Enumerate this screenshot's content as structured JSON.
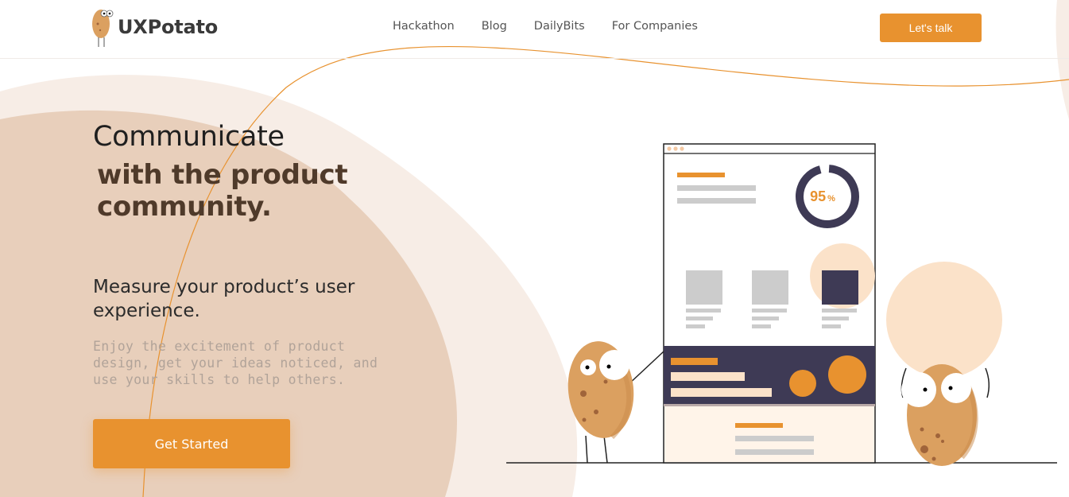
{
  "brand": {
    "name": "UXPotato"
  },
  "nav": {
    "links": [
      "Hackathon",
      "Blog",
      "DailyBits",
      "For Companies"
    ],
    "cta_label": "Let's talk"
  },
  "hero": {
    "headline_line1": "Communicate",
    "headline_line2": "with the product community.",
    "subheadline": "Measure your product’s user experience.",
    "description": "Enjoy the excitement of product design, get your ideas noticed, and use your skills to help others.",
    "cta_label": "Get Started"
  },
  "illustration": {
    "score_value": "95",
    "score_unit": "%",
    "score_fraction": 0.95
  },
  "colors": {
    "accent": "#e8922f",
    "dark_navy": "#3e3a55",
    "blob_dark": "#e8cfbb",
    "blob_light": "#f7ede6",
    "peach": "#fbe2c9",
    "potato": "#dba060"
  }
}
